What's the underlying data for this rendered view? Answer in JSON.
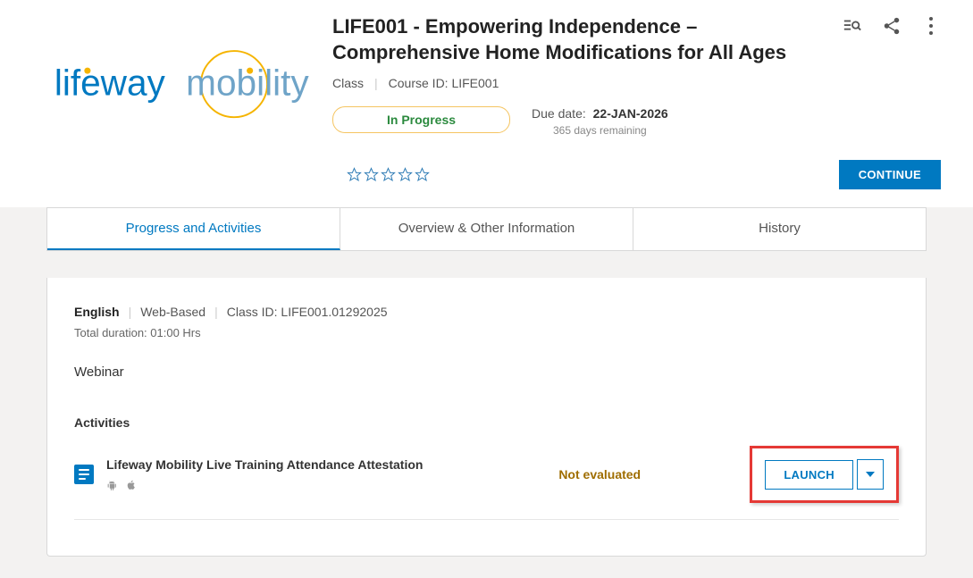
{
  "logo": {
    "text_a": "lifeway",
    "text_b": "mobility"
  },
  "course": {
    "title": "LIFE001 - Empowering Independence – Comprehensive Home Modifications for All Ages",
    "type": "Class",
    "id_label": "Course ID: LIFE001",
    "status": "In Progress",
    "due_label": "Due date:",
    "due_date": "22-JAN-2026",
    "remaining": "365 days remaining"
  },
  "actions": {
    "continue": "CONTINUE"
  },
  "tabs": {
    "t0": "Progress and Activities",
    "t1": "Overview & Other Information",
    "t2": "History"
  },
  "class_detail": {
    "language": "English",
    "delivery": "Web-Based",
    "id_label": "Class ID: LIFE001.01292025",
    "duration": "Total duration: 01:00 Hrs",
    "format": "Webinar"
  },
  "activities": {
    "heading": "Activities",
    "item0": {
      "title": "Lifeway Mobility Live Training Attendance Attestation",
      "status": "Not evaluated",
      "launch": "LAUNCH"
    }
  }
}
